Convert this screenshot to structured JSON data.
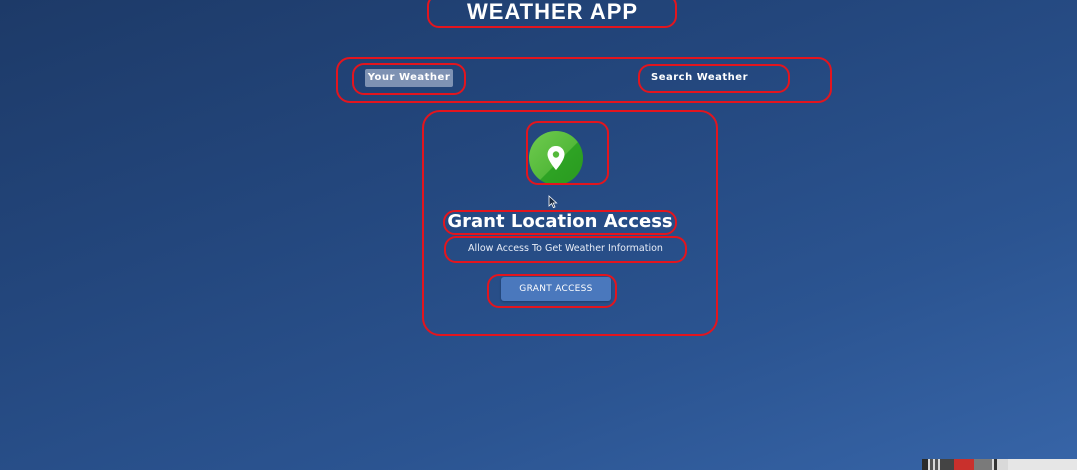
{
  "app": {
    "title": "WEATHER APP"
  },
  "tabs": [
    {
      "label": "Your Weather",
      "active": true
    },
    {
      "label": "Search Weather",
      "active": false
    }
  ],
  "grant": {
    "icon": "location-pin-icon",
    "title": "Grant Location Access",
    "subtitle": "Allow Access To Get Weather Information",
    "button_label": "GRANT ACCESS"
  },
  "colors": {
    "background_top": "#1d3a68",
    "background_bottom": "#3765a8",
    "annotation": "#e3151e",
    "icon_green": "#54b93a",
    "button": "#4a78bd"
  }
}
